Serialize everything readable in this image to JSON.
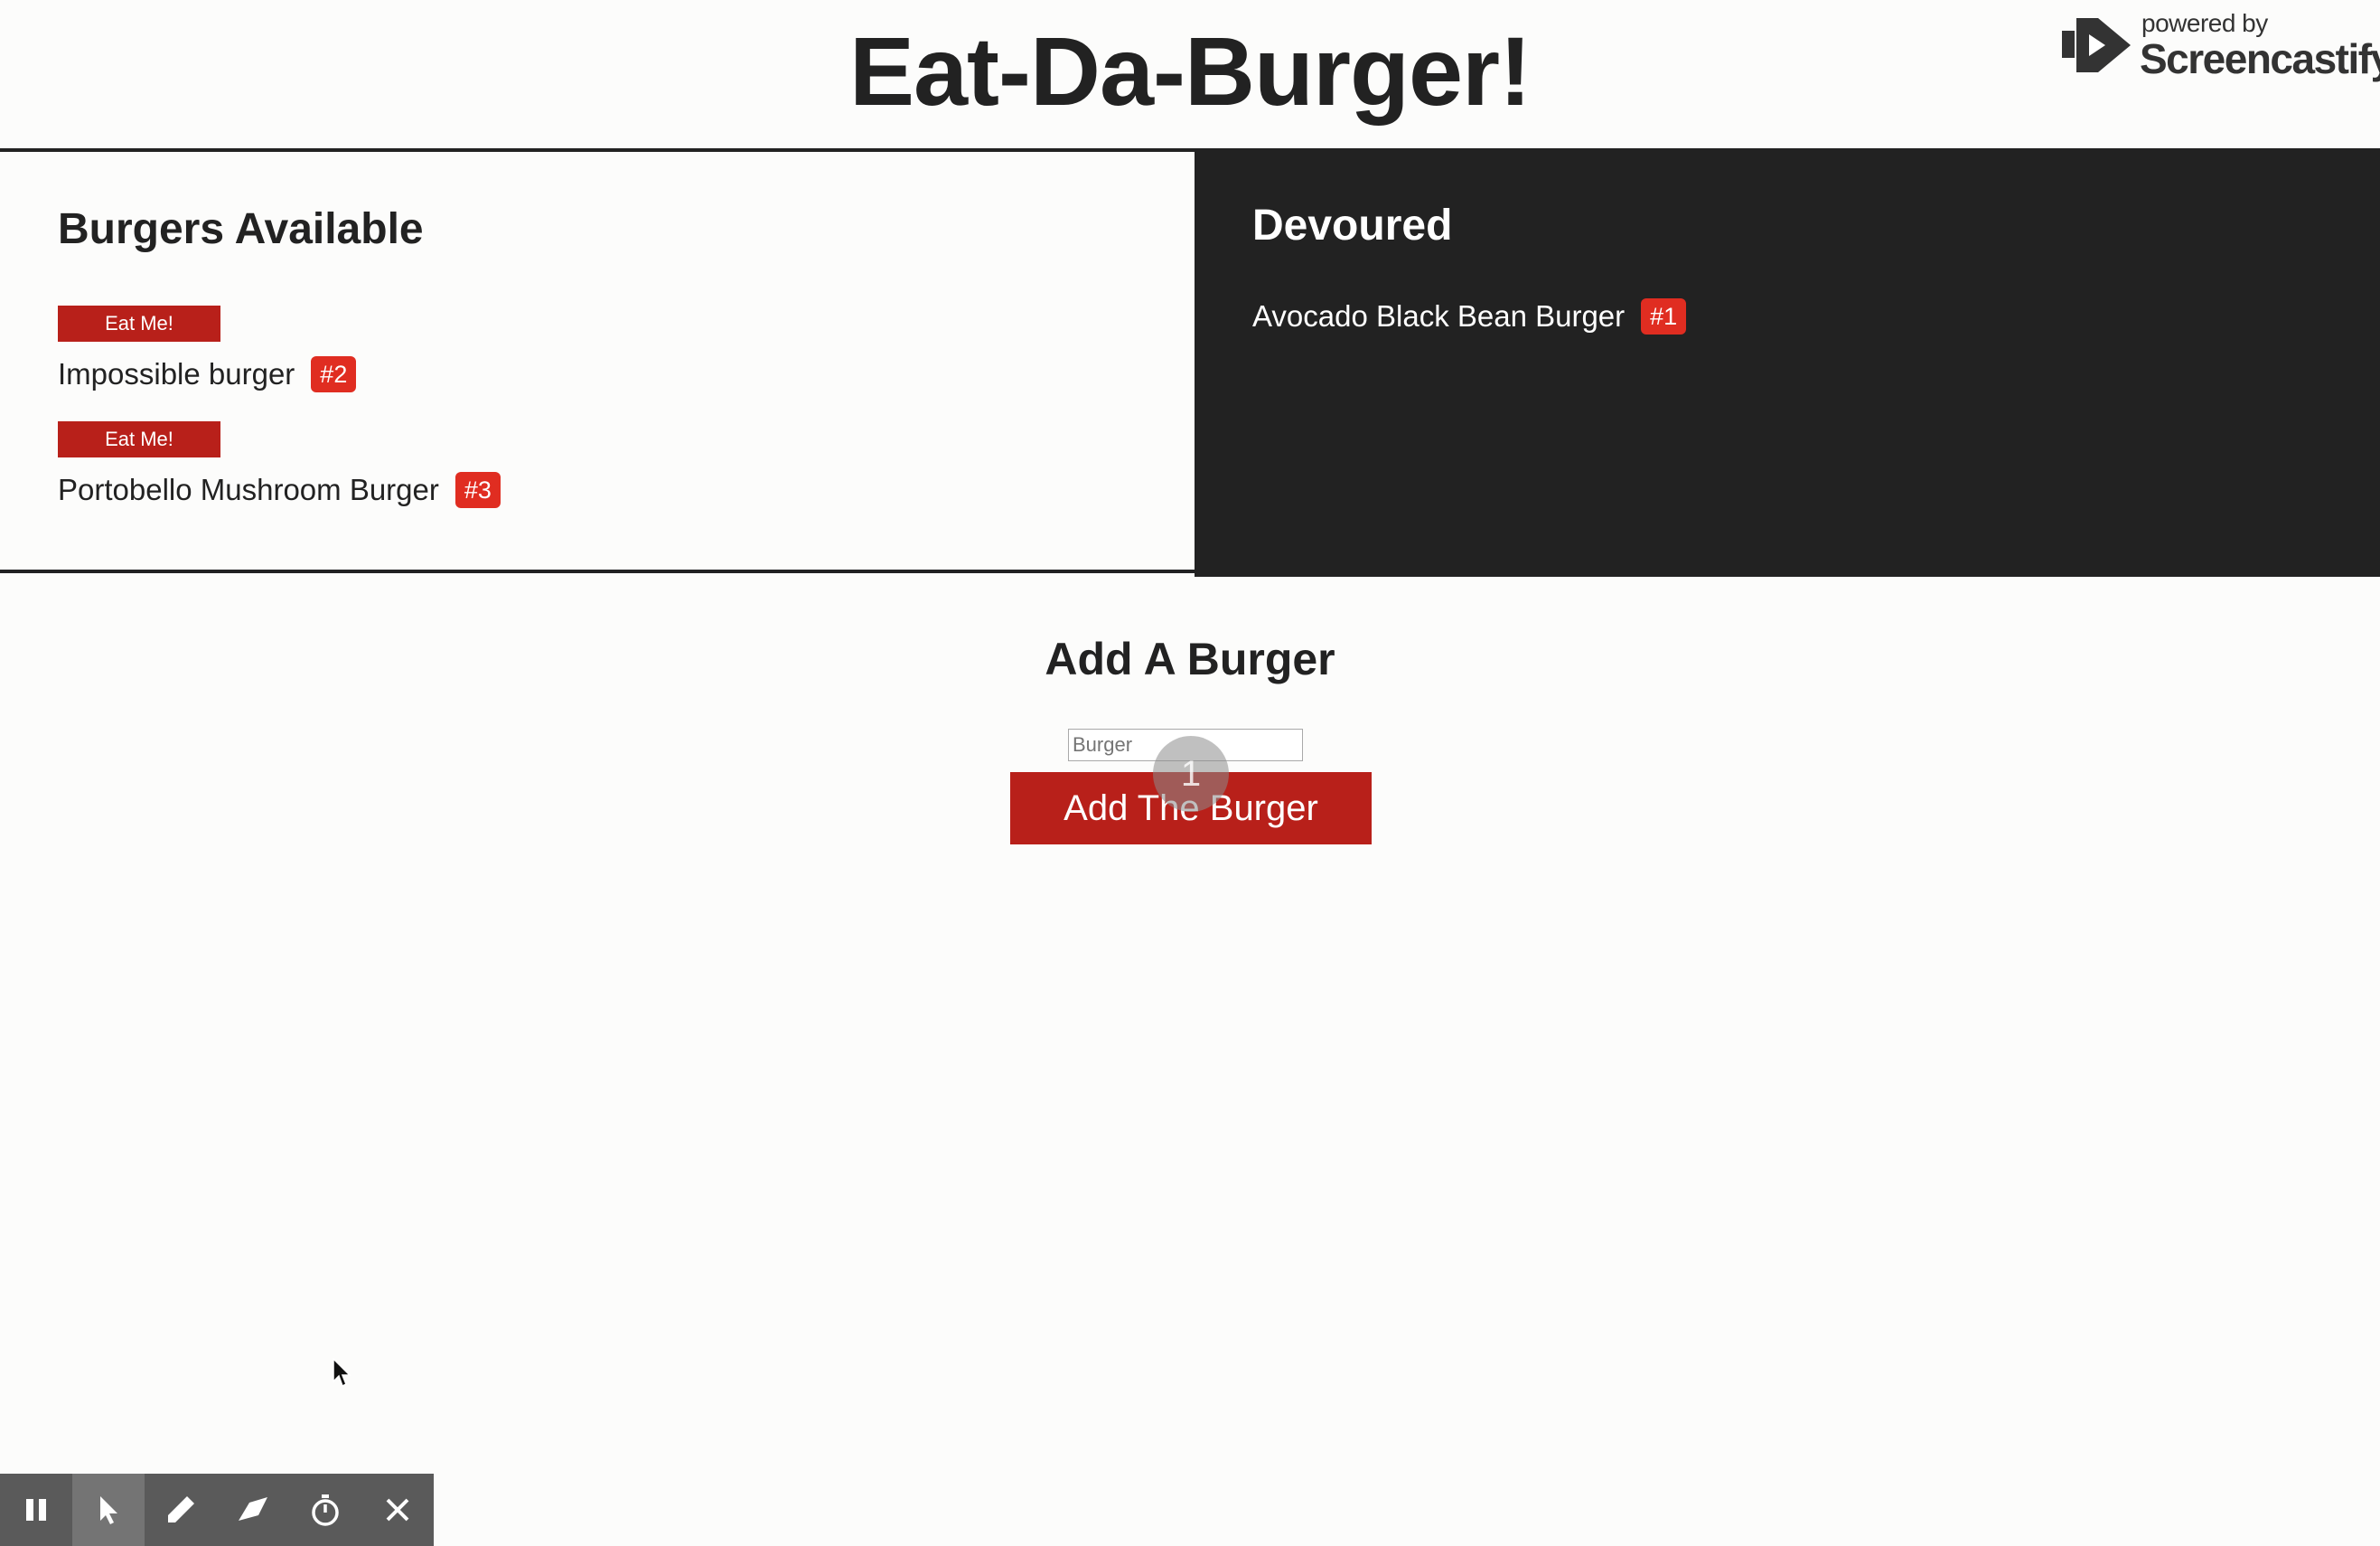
{
  "header": {
    "title": "Eat-Da-Burger!"
  },
  "watermark": {
    "powered_by": "powered by",
    "brand": "Screencastify"
  },
  "available": {
    "heading": "Burgers Available",
    "items": [
      {
        "button_label": "Eat Me!",
        "name": "Impossible burger",
        "badge": "#2"
      },
      {
        "button_label": "Eat Me!",
        "name": "Portobello Mushroom Burger",
        "badge": "#3"
      }
    ]
  },
  "devoured": {
    "heading": "Devoured",
    "items": [
      {
        "name": "Avocado Black Bean Burger",
        "badge": "#1"
      }
    ]
  },
  "add_form": {
    "heading": "Add A Burger",
    "input_placeholder": "Burger",
    "button_label": "Add The Burger"
  },
  "click_indicator": {
    "count": "1"
  },
  "recorder_toolbar": {
    "tools": [
      "pause-icon",
      "pointer-icon",
      "pen-icon",
      "eraser-icon",
      "timer-icon",
      "close-icon"
    ]
  },
  "colors": {
    "accent": "#b8201a",
    "badge": "#e02d21",
    "dark_panel": "#222222",
    "background": "#fcfcfb"
  }
}
